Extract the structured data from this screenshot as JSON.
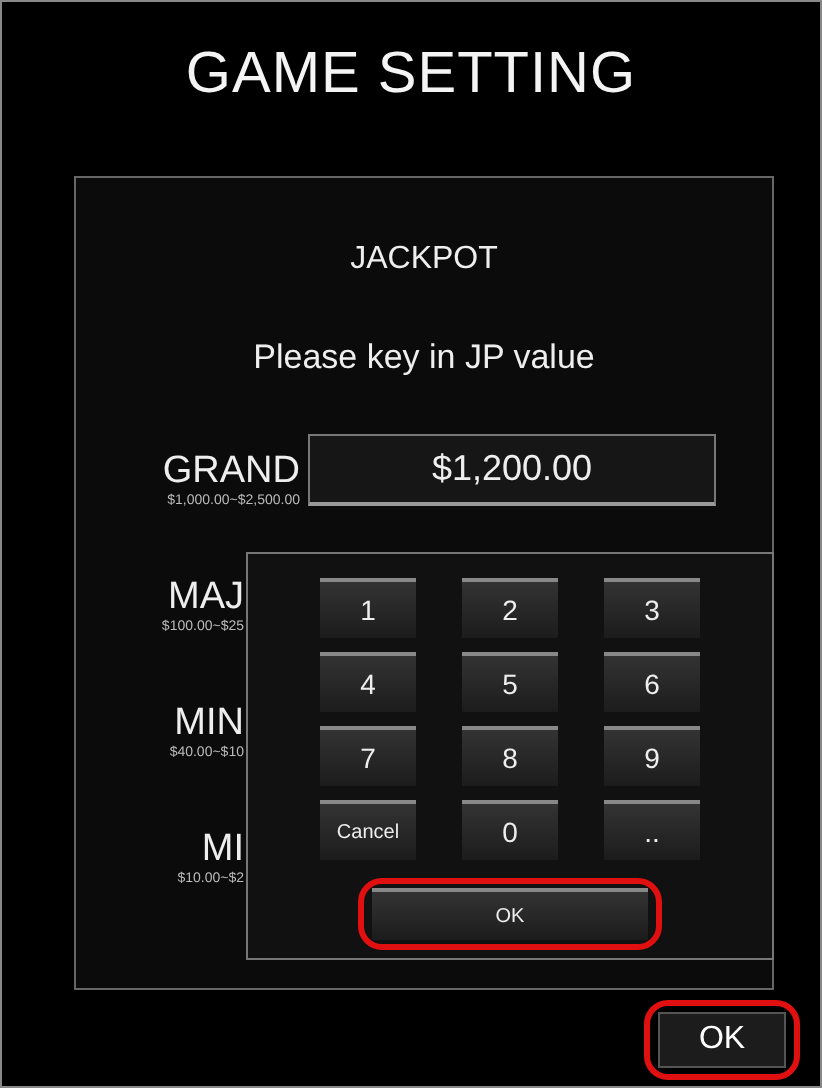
{
  "title": "GAME SETTING",
  "panel": {
    "heading": "JACKPOT",
    "prompt": "Please key in JP value",
    "levels": [
      {
        "name": "GRAND",
        "range": "$1,000.00~$2,500.00",
        "value": "$1,200.00"
      },
      {
        "name": "MAJ",
        "range": "$100.00~$25"
      },
      {
        "name": "MIN",
        "range": "$40.00~$10"
      },
      {
        "name": "MI",
        "range": "$10.00~$2"
      }
    ]
  },
  "keypad": {
    "keys": [
      {
        "label": "1",
        "kind": "digit"
      },
      {
        "label": "2",
        "kind": "digit"
      },
      {
        "label": "3",
        "kind": "digit"
      },
      {
        "label": "4",
        "kind": "digit"
      },
      {
        "label": "5",
        "kind": "digit"
      },
      {
        "label": "6",
        "kind": "digit"
      },
      {
        "label": "7",
        "kind": "digit"
      },
      {
        "label": "8",
        "kind": "digit"
      },
      {
        "label": "9",
        "kind": "digit"
      },
      {
        "label": "Cancel",
        "kind": "action"
      },
      {
        "label": "0",
        "kind": "digit"
      },
      {
        "label": "..",
        "kind": "digit"
      }
    ],
    "ok": {
      "label": "OK",
      "highlighted": true
    }
  },
  "ok_button": {
    "label": "OK",
    "highlighted": true
  }
}
